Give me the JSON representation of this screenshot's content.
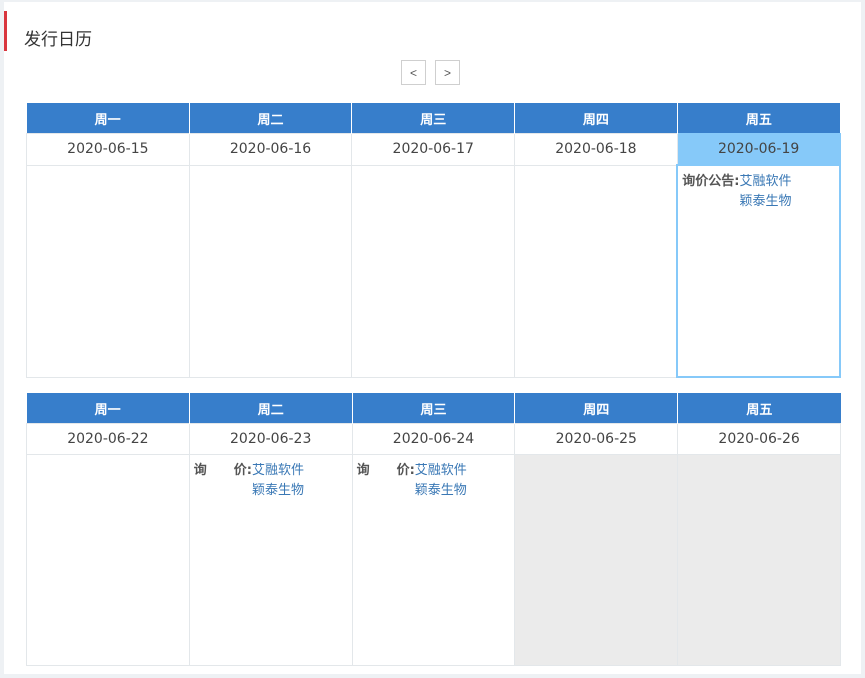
{
  "title": "发行日历",
  "nav": {
    "prev": "<",
    "next": ">"
  },
  "weeks": [
    {
      "days": [
        "周一",
        "周二",
        "周三",
        "周四",
        "周五"
      ],
      "dates": [
        "2020-06-15",
        "2020-06-16",
        "2020-06-17",
        "2020-06-18",
        "2020-06-19"
      ],
      "entries": {
        "fri": {
          "label": "询价公告:",
          "items": [
            "艾融软件",
            "颖泰生物"
          ]
        }
      }
    },
    {
      "days": [
        "周一",
        "周二",
        "周三",
        "周四",
        "周五"
      ],
      "dates": [
        "2020-06-22",
        "2020-06-23",
        "2020-06-24",
        "2020-06-25",
        "2020-06-26"
      ],
      "entries": {
        "tue": {
          "label_a": "询",
          "label_b": "价:",
          "items": [
            "艾融软件",
            "颖泰生物"
          ]
        },
        "wed": {
          "label_a": "询",
          "label_b": "价:",
          "items": [
            "艾融软件",
            "颖泰生物"
          ]
        }
      }
    }
  ],
  "colors": {
    "header": "#377ecb",
    "selected": "#86c9f9",
    "accent": "#d9363e",
    "link": "#3a78b5",
    "inactive": "#ebebeb"
  }
}
